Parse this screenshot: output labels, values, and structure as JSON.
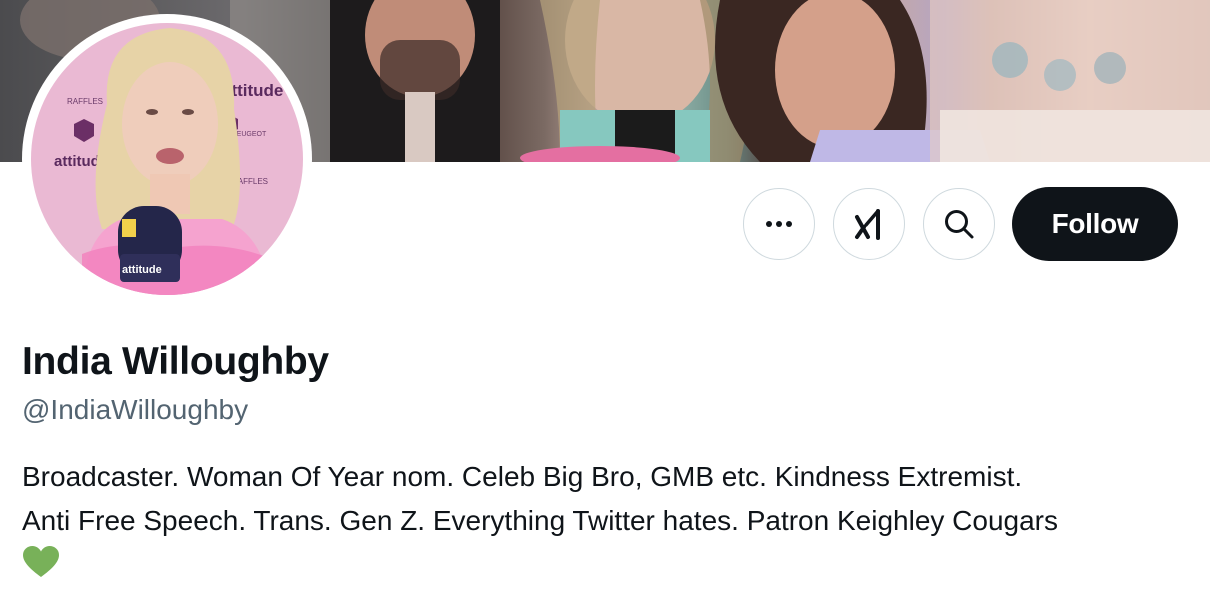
{
  "profile": {
    "display_name": "India Willoughby",
    "handle": "@IndiaWilloughby",
    "bio_lines": [
      "Broadcaster. Woman Of Year nom. Celeb Big Bro, GMB etc. Kindness Extremist.",
      "Anti Free Speech. Trans. Gen Z. Everything Twitter hates. Patron Keighley Cougars"
    ],
    "bio_emoji_icon": "green-heart-icon"
  },
  "avatar": {
    "backdrop_text": [
      "attitude",
      "RAFFLES",
      "PEUGEOT",
      "attitude",
      "RAFFLES"
    ],
    "mic_text": "attitude"
  },
  "actions": {
    "more_icon": "ellipsis-icon",
    "grok_icon": "grok-icon",
    "search_icon": "search-icon",
    "follow_label": "Follow"
  },
  "colors": {
    "follow_bg": "#0f1419",
    "secondary_text": "#536471",
    "heart": "#78b159"
  }
}
